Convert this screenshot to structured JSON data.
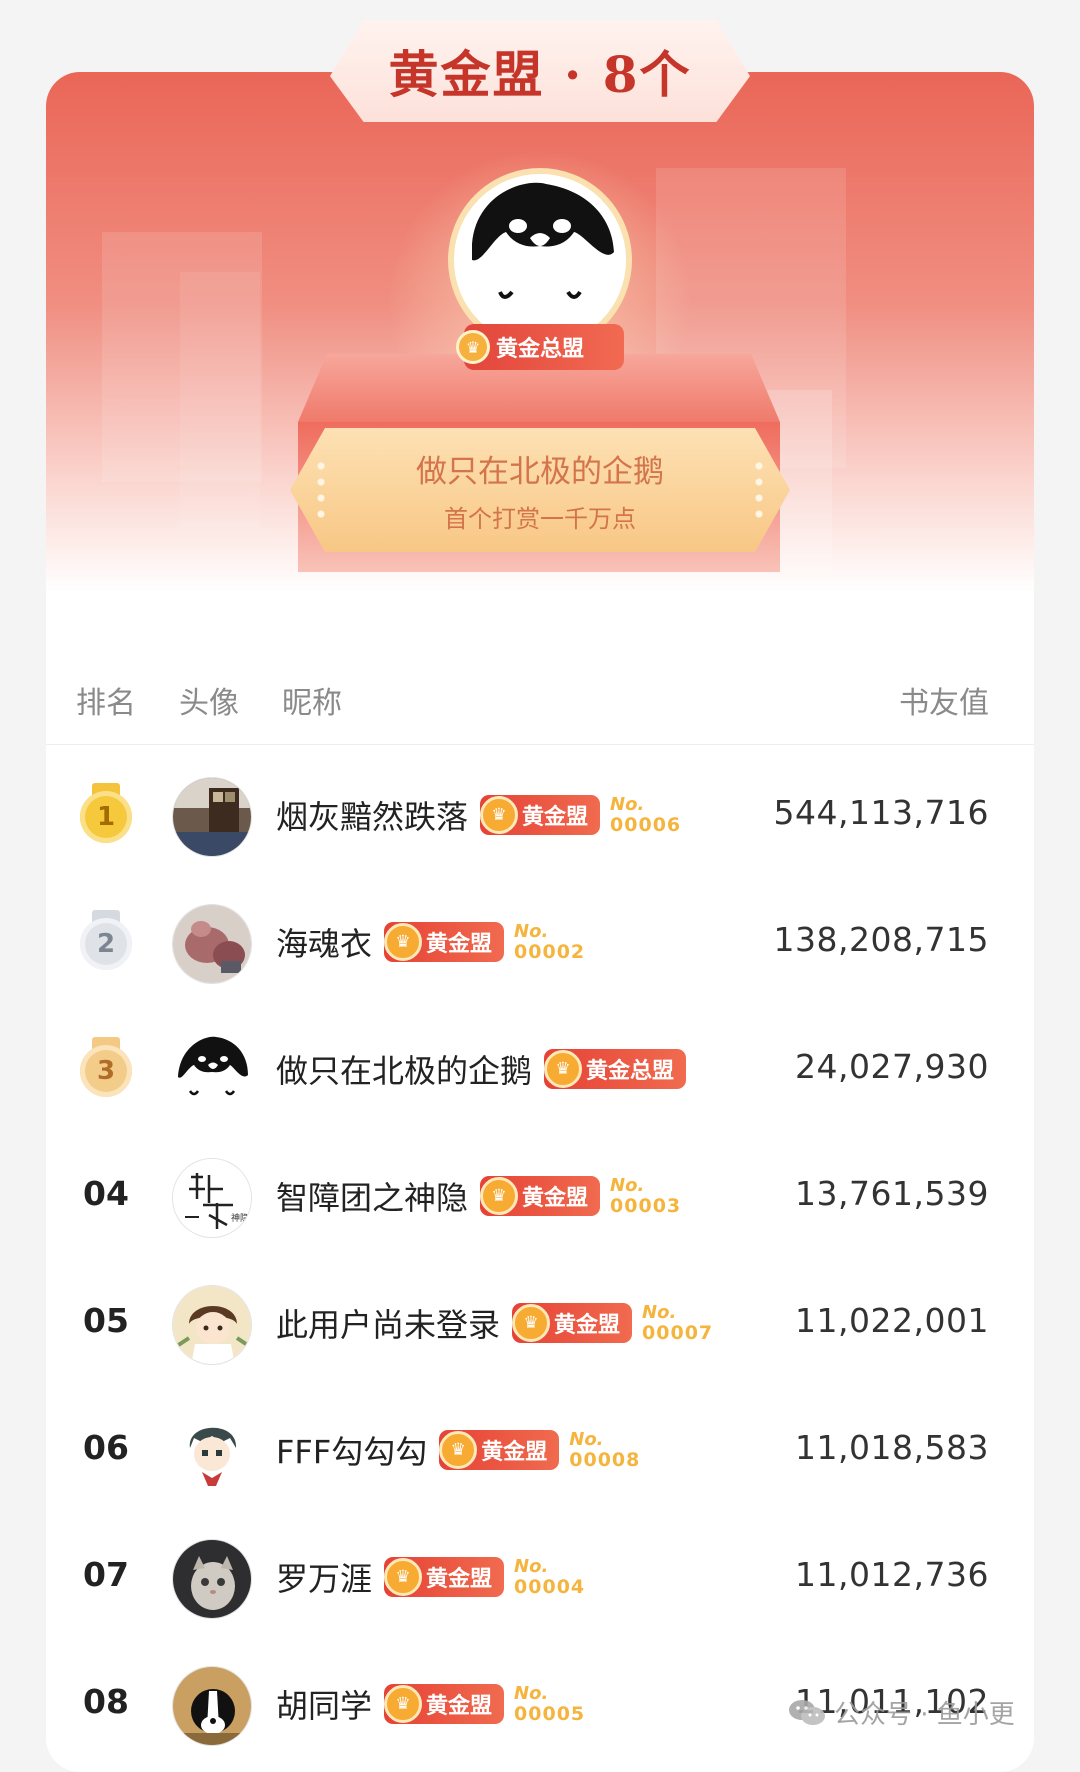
{
  "header": {
    "title": "黄金盟 · 8个",
    "top_avatar_badge": "黄金总盟",
    "top_user_name": "做只在北极的企鹅",
    "top_user_note": "首个打赏一千万点"
  },
  "columns": {
    "rank": "排名",
    "avatar": "头像",
    "nickname": "昵称",
    "value": "书友值"
  },
  "rows": [
    {
      "rank": "1",
      "medal": "gold",
      "name": "烟灰黯然跌落",
      "badge": "黄金盟",
      "no_label": "No.",
      "serial": "00006",
      "value": "544,113,716"
    },
    {
      "rank": "2",
      "medal": "silver",
      "name": "海魂衣",
      "badge": "黄金盟",
      "no_label": "No.",
      "serial": "00002",
      "value": "138,208,715"
    },
    {
      "rank": "3",
      "medal": "bronze",
      "name": "做只在北极的企鹅",
      "badge": "黄金总盟",
      "no_label": "",
      "serial": "",
      "value": "24,027,930"
    },
    {
      "rank": "04",
      "medal": "",
      "name": "智障团之神隐",
      "badge": "黄金盟",
      "no_label": "No.",
      "serial": "00003",
      "value": "13,761,539"
    },
    {
      "rank": "05",
      "medal": "",
      "name": "此用户尚未登录",
      "badge": "黄金盟",
      "no_label": "No.",
      "serial": "00007",
      "value": "11,022,001"
    },
    {
      "rank": "06",
      "medal": "",
      "name": "FFF勾勾勾",
      "badge": "黄金盟",
      "no_label": "No.",
      "serial": "00008",
      "value": "11,018,583"
    },
    {
      "rank": "07",
      "medal": "",
      "name": "罗万涯",
      "badge": "黄金盟",
      "no_label": "No.",
      "serial": "00004",
      "value": "11,012,736"
    },
    {
      "rank": "08",
      "medal": "",
      "name": "胡同学",
      "badge": "黄金盟",
      "no_label": "No.",
      "serial": "00005",
      "value": "11,011,102"
    }
  ],
  "watermark": "公众号 · 鱼小更",
  "colors": {
    "accent_red": "#e64236",
    "gold": "#f5b43d",
    "hero_top": "#ea6657"
  }
}
